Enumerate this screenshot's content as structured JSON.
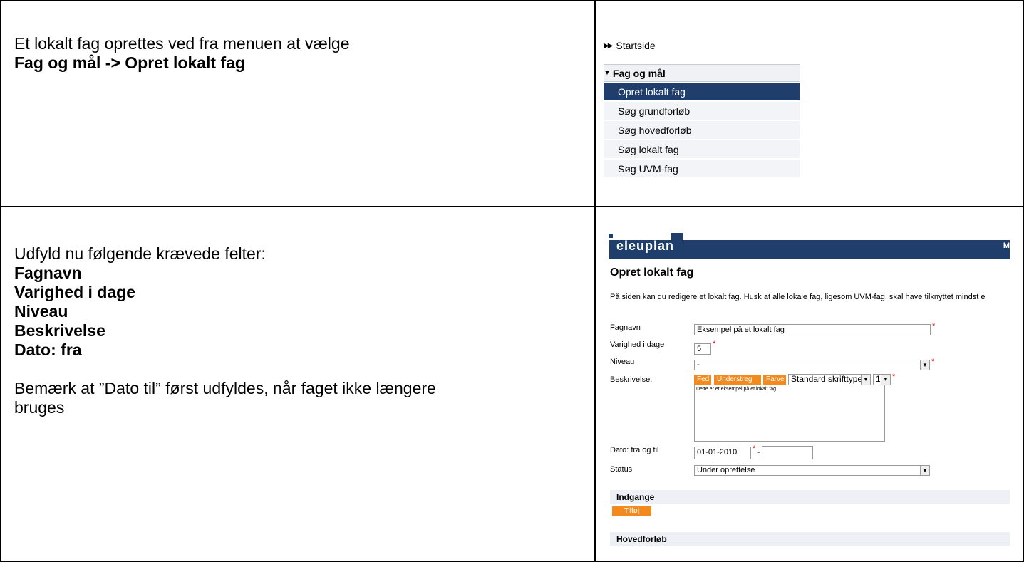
{
  "row1": {
    "intro": "Et lokalt fag oprettes ved fra menuen at vælge",
    "path": "Fag og mål -> Opret lokalt fag"
  },
  "menu": {
    "start": "Startside",
    "group": "Fag og mål",
    "items": [
      "Opret lokalt fag",
      "Søg grundforløb",
      "Søg hovedforløb",
      "Søg lokalt fag",
      "Søg UVM-fag"
    ]
  },
  "row2": {
    "intro": "Udfyld nu følgende krævede felter:",
    "fields": [
      "Fagnavn",
      "Varighed i dage",
      "Niveau",
      "Beskrivelse",
      "Dato:  fra"
    ],
    "note_line1": "Bemærk at ”Dato til” først udfyldes, når faget ikke længere",
    "note_line2": "bruges"
  },
  "form": {
    "logo": "eleuplan",
    "corner": "M",
    "title": "Opret lokalt fag",
    "intro": "På siden kan du redigere et lokalt fag. Husk at alle lokale fag, ligesom UVM-fag, skal have tilknyttet mindst e",
    "labels": {
      "fagnavn": "Fagnavn",
      "varighed": "Varighed i dage",
      "niveau": "Niveau",
      "beskrivelse": "Beskrivelse:",
      "dato": "Dato: fra og til",
      "status": "Status"
    },
    "values": {
      "fagnavn": "Eksempel på et lokalt fag",
      "varighed": "5",
      "niveau": "-",
      "font": "Standard skrifttype",
      "size": "1",
      "beskrivelse": "Dette er et eksempel på et lokalt fag.",
      "dato_fra": "01-01-2010",
      "dato_til": "",
      "status": "Under oprettelse"
    },
    "editor_buttons": [
      "Fed",
      "Understreg",
      "Farve"
    ],
    "required_mark": "*",
    "date_sep": "-",
    "sections": {
      "indgange": "Indgange",
      "add_button": "Tilføj",
      "hovedforlob": "Hovedforløb"
    }
  },
  "colors": {
    "navy": "#1f3e6b",
    "orange": "#f28a1e",
    "required": "#dd0000"
  }
}
